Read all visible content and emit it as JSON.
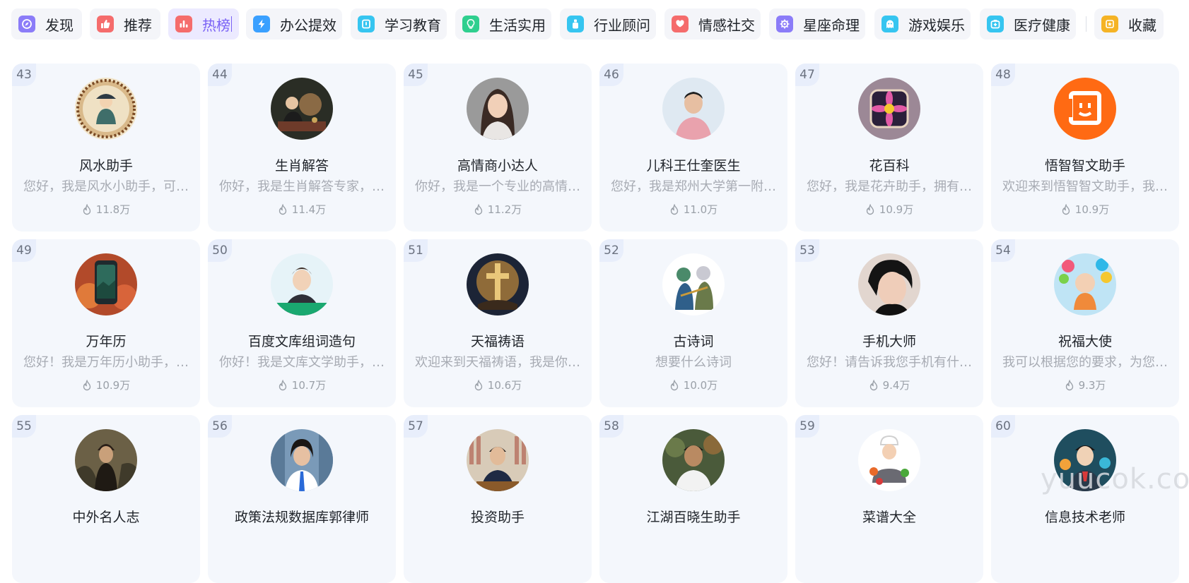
{
  "tabs": [
    {
      "label": "发现",
      "icon": "compass-icon",
      "color": "#8b7cf8"
    },
    {
      "label": "推荐",
      "icon": "thumbs-up-icon",
      "color": "#f56c6c"
    },
    {
      "label": "热榜",
      "icon": "bar-chart-icon",
      "color": "#f56c6c",
      "active": true
    },
    {
      "label": "办公提效",
      "icon": "lightning-icon",
      "color": "#3aa0ff"
    },
    {
      "label": "学习教育",
      "icon": "book-icon",
      "color": "#36c5f0"
    },
    {
      "label": "生活实用",
      "icon": "bulb-icon",
      "color": "#2fcf8f"
    },
    {
      "label": "行业顾问",
      "icon": "badge-icon",
      "color": "#36c5f0"
    },
    {
      "label": "情感社交",
      "icon": "heart-chat-icon",
      "color": "#f56c6c"
    },
    {
      "label": "星座命理",
      "icon": "gear-star-icon",
      "color": "#8b7cf8"
    },
    {
      "label": "游戏娱乐",
      "icon": "ghost-icon",
      "color": "#36c5f0"
    },
    {
      "label": "医疗健康",
      "icon": "medkit-icon",
      "color": "#36c5f0"
    },
    {
      "label": "收藏",
      "icon": "star-icon",
      "color": "#f5b325"
    }
  ],
  "cards": [
    {
      "rank": "43",
      "name": "风水助手",
      "desc": "您好，我是风水小助手，可以为您解答",
      "heat": "11.8万"
    },
    {
      "rank": "44",
      "name": "生肖解答",
      "desc": "你好，我是生肖解答专家，有什么问题",
      "heat": "11.4万"
    },
    {
      "rank": "45",
      "name": "高情商小达人",
      "desc": "你好，我是一个专业的高情商沟通助手",
      "heat": "11.2万"
    },
    {
      "rank": "46",
      "name": "儿科王仕奎医生",
      "desc": "您好，我是郑州大学第一附属医院儿科",
      "heat": "11.0万"
    },
    {
      "rank": "47",
      "name": "花百科",
      "desc": "您好，我是花卉助手，拥有丰富的花卉",
      "heat": "10.9万"
    },
    {
      "rank": "48",
      "name": "悟智智文助手",
      "desc": "欢迎来到悟智智文助手，我可以帮助你",
      "heat": "10.9万"
    },
    {
      "rank": "49",
      "name": "万年历",
      "desc": "您好！我是万年历小助手，可以帮您查询",
      "heat": "10.9万"
    },
    {
      "rank": "50",
      "name": "百度文库组词造句",
      "desc": "你好！我是文库文学助手，可以帮你组词",
      "heat": "10.7万"
    },
    {
      "rank": "51",
      "name": "天福祷语",
      "desc": "欢迎来到天福祷语，我是你的祷告助手",
      "heat": "10.6万"
    },
    {
      "rank": "52",
      "name": "古诗词",
      "desc": "想要什么诗词",
      "heat": "10.0万"
    },
    {
      "rank": "53",
      "name": "手机大师",
      "desc": "您好！请告诉我您手机有什么问题",
      "heat": "9.4万"
    },
    {
      "rank": "54",
      "name": "祝福大使",
      "desc": "我可以根据您的要求，为您生成祝福语",
      "heat": "9.3万"
    },
    {
      "rank": "55",
      "name": "中外名人志",
      "desc": "",
      "heat": ""
    },
    {
      "rank": "56",
      "name": "政策法规数据库郭律师",
      "desc": "",
      "heat": ""
    },
    {
      "rank": "57",
      "name": "投资助手",
      "desc": "",
      "heat": ""
    },
    {
      "rank": "58",
      "name": "江湖百晓生助手",
      "desc": "",
      "heat": ""
    },
    {
      "rank": "59",
      "name": "菜谱大全",
      "desc": "",
      "heat": ""
    },
    {
      "rank": "60",
      "name": "信息技术老师",
      "desc": "",
      "heat": ""
    }
  ],
  "watermark": "yuucok.com"
}
